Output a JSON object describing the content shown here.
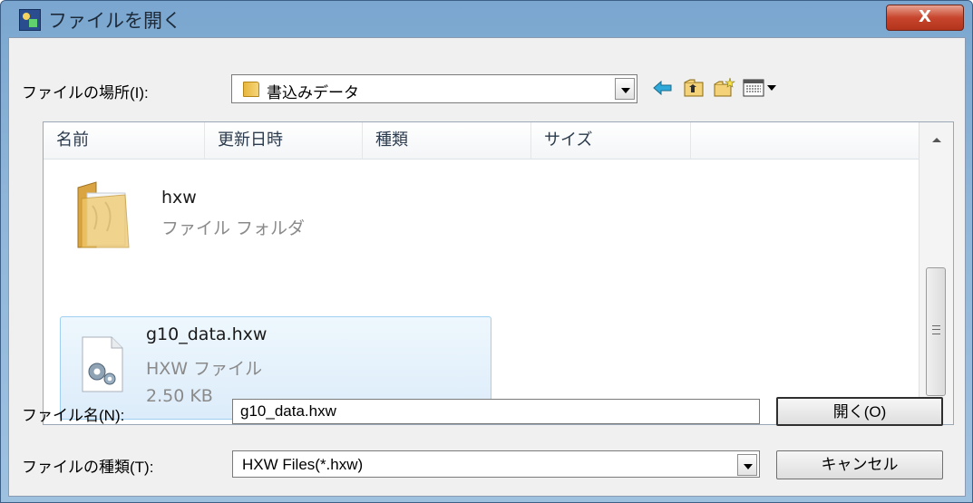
{
  "window": {
    "title": "ファイルを開く",
    "close_label": "X"
  },
  "location": {
    "label": "ファイルの場所(I):",
    "value": "書込みデータ"
  },
  "toolbar": {
    "icons": [
      "back-arrow-icon",
      "up-folder-icon",
      "new-folder-icon",
      "view-menu-icon"
    ]
  },
  "list": {
    "columns": [
      "名前",
      "更新日時",
      "種類",
      "サイズ"
    ],
    "items": [
      {
        "name": "hxw",
        "type": "ファイル フォルダ",
        "icon": "folder-icon"
      },
      {
        "name": "g10_data.hxw",
        "type": "HXW ファイル",
        "size": "2.50 KB",
        "icon": "settings-file-icon"
      }
    ]
  },
  "filename": {
    "label": "ファイル名(N):",
    "value": "g10_data.hxw"
  },
  "filetype": {
    "label": "ファイルの種類(T):",
    "value": "HXW Files(*.hxw)"
  },
  "buttons": {
    "open": "開く(O)",
    "cancel": "キャンセル"
  },
  "colors": {
    "titlebar": "#8fb6d9",
    "selection_border": "#9fd0f2",
    "close_button": "#c7452c"
  }
}
